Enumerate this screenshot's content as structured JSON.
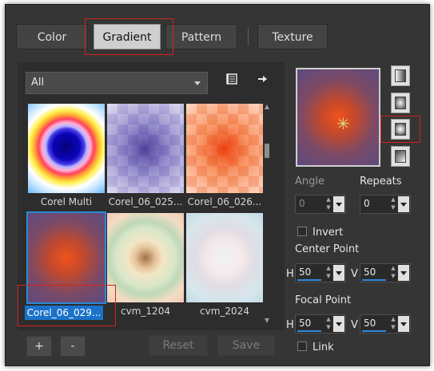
{
  "tabs": [
    {
      "label": "Color"
    },
    {
      "label": "Gradient"
    },
    {
      "label": "Pattern"
    },
    {
      "label": "Texture"
    }
  ],
  "gallery": {
    "category_select": "All",
    "items": [
      {
        "label": "Corel Multi"
      },
      {
        "label": "Corel_06_025..."
      },
      {
        "label": "Corel_06_026..."
      },
      {
        "label": "Corel_06_029..."
      },
      {
        "label": "cvm_1204"
      },
      {
        "label": "cvm_2024"
      }
    ]
  },
  "actions": {
    "add": "+",
    "remove": "-",
    "reset": "Reset",
    "save": "Save"
  },
  "properties": {
    "angle_label": "Angle",
    "angle_value": "0",
    "repeats_label": "Repeats",
    "repeats_value": "0",
    "invert_label": "Invert",
    "center_point_label": "Center Point",
    "center_h_label": "H",
    "center_h_value": "50",
    "center_v_label": "V",
    "center_v_value": "50",
    "focal_point_label": "Focal Point",
    "focal_h_label": "H",
    "focal_h_value": "50",
    "focal_v_label": "V",
    "focal_v_value": "50",
    "link_label": "Link"
  },
  "colors": {
    "selection_blue": "#1a72c9",
    "highlight_red": "#d62020",
    "slider_blue": "#2e8ae0"
  },
  "icons": {
    "dropdown": "chevron-down-icon",
    "gradient_library": "gradient-library-icon",
    "export": "arrow-right-icon",
    "linear": "linear-gradient-icon",
    "rectangular": "rectangular-gradient-icon",
    "sunburst": "sunburst-gradient-icon",
    "corner": "corner-gradient-icon"
  }
}
